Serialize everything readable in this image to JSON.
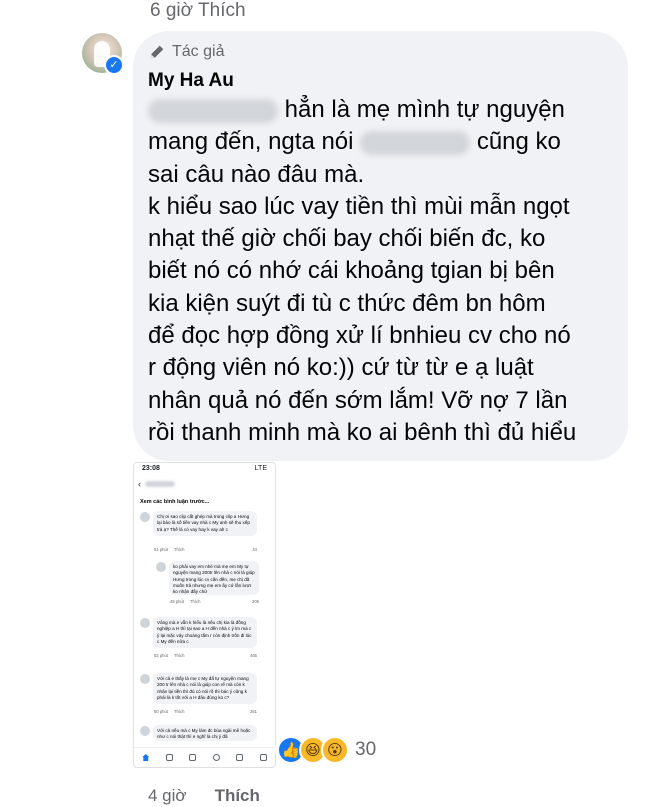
{
  "top_partial_text": "6 giờ   Thích",
  "comment": {
    "badge_label": "Tác giả",
    "author_name": "My Ha Au",
    "lines": [
      {
        "before": "",
        "blur_width": 130,
        "after": " hẳn là mẹ mình tự nguyện"
      },
      {
        "before": "mang đến, ngta nói ",
        "blur_width": 110,
        "after": " cũng ko"
      },
      {
        "before": "sai câu nào đâu mà.",
        "blur_width": 0,
        "after": ""
      },
      {
        "before": "k hiểu sao lúc vay tiền thì mùi mẫn ngọt",
        "blur_width": 0,
        "after": ""
      },
      {
        "before": "nhạt thế giờ chối bay chối biến đc, ko",
        "blur_width": 0,
        "after": ""
      },
      {
        "before": "biết nó có nhớ cái khoảng tgian bị bên",
        "blur_width": 0,
        "after": ""
      },
      {
        "before": "kia kiện suýt đi tù c thức đêm bn hôm",
        "blur_width": 0,
        "after": ""
      },
      {
        "before": "để đọc hợp đồng xử lí bnhieu cv cho nó",
        "blur_width": 0,
        "after": ""
      },
      {
        "before": "r động viên nó ko:)) cứ từ từ e ạ luật",
        "blur_width": 0,
        "after": ""
      },
      {
        "before": "nhân quả nó đến sớm lắm! Vỡ nợ 7 lần",
        "blur_width": 0,
        "after": ""
      },
      {
        "before": "rồi thanh minh mà ko ai bênh thì đủ hiểu",
        "blur_width": 0,
        "after": ""
      }
    ]
  },
  "screenshot": {
    "status_time": "23:08",
    "status_signal": "LTE",
    "sort_label": "Xem các bình luận trước...",
    "mini_comments": [
      {
        "text": "Chị ơi sao clip cắt ghép mà trong clip a Hưng lại bảo là số tiền vay nhà c My anh sẽ thu xếp trả ạ? Thế là có vay hay k vay ah c",
        "time": "51 phút",
        "like": "Thích",
        "reaction": "44"
      },
      {
        "text": "ko phải vay em nhé mà mẹ em My tự nguyện mang 200tr lên nhà c nói là giúp Hưng trong lúc cv cần đến, mẹ chị đã muốn trả nhưng mẹ em ấy cứ lần lượt ko nhận đấy chứ",
        "time": "48 phút",
        "like": "Thích",
        "reaction": "206"
      },
      {
        "text": "Vâng mà e vẫn k hiểu là nếu chị kia là đồng nghiệp a H thì tại sao a H đến nhà c ý lm mà c ý lại mặc váy choàng tắm r còn định trốn đi lúc c My đến nữa c",
        "time": "52 phút",
        "like": "Thích",
        "reaction": "465"
      },
      {
        "text": "Với cả e thấy là mẹ c My đã tự nguyện mang 200 tr lên nhà c nói là giúp con rể mà còn k nhận lại tiền thì đủ có nói rõ thì bác ý cũng k phải là k tốt với a H đâu đúng ko c?",
        "time": "50 phút",
        "like": "Thích",
        "reaction": "361"
      },
      {
        "text": "Với cả nếu mà c My làm đc bùa ngải mê hoặc như c nói thật thì e nghĩ là chị ý đã",
        "time": "",
        "like": "",
        "reaction": ""
      }
    ]
  },
  "reactions": {
    "count": "30",
    "types": [
      "like-icon",
      "haha-icon",
      "wow-icon"
    ],
    "like_color": "#1877f2",
    "emoji_color": "#f7b928"
  },
  "actions": {
    "time": "4 giờ",
    "like": "Thích"
  }
}
